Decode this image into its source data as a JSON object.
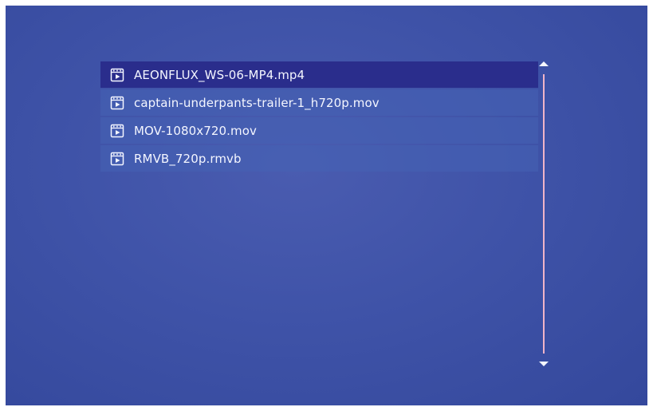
{
  "file_list": {
    "items": [
      {
        "label": "AEONFLUX_WS-06-MP4.mp4",
        "icon": "video-file-icon",
        "selected": true
      },
      {
        "label": "captain-underpants-trailer-1_h720p.mov",
        "icon": "video-file-icon",
        "selected": false
      },
      {
        "label": "MOV-1080x720.mov",
        "icon": "video-file-icon",
        "selected": false
      },
      {
        "label": "RMVB_720p.rmvb",
        "icon": "video-file-icon",
        "selected": false
      }
    ]
  },
  "scrollbar": {
    "up_icon": "triangle-up-icon",
    "down_icon": "triangle-down-icon",
    "track_color": "#f0b4c8"
  },
  "colors": {
    "background": "#3f53a8",
    "selected_row": "#2a2d8c",
    "row": "#4662b4",
    "text": "#f4f6ff"
  }
}
